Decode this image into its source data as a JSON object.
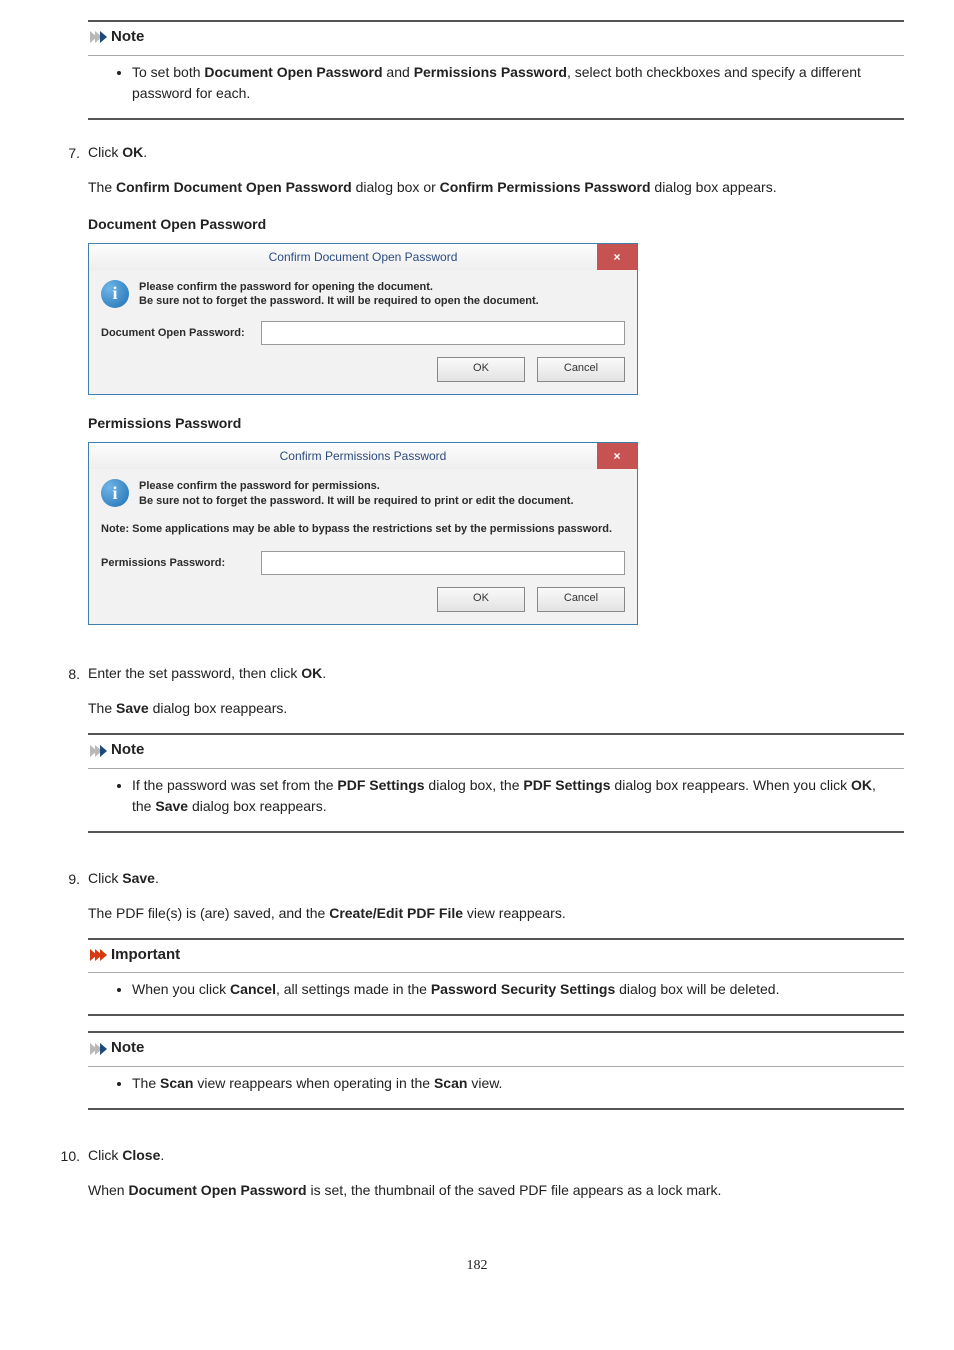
{
  "labels": {
    "note": "Note",
    "important": "Important"
  },
  "note1": {
    "bullet_pre": "To set both ",
    "bold1": "Document Open Password",
    "mid1": " and ",
    "bold2": "Permissions Password",
    "post": ", select both checkboxes and specify a different password for each."
  },
  "step7": {
    "num": "7.",
    "line_pre": "Click ",
    "line_bold": "OK",
    "line_post": ".",
    "p_pre": "The ",
    "p_b1": "Confirm Document Open Password",
    "p_mid": " dialog box or ",
    "p_b2": "Confirm Permissions Password",
    "p_post": " dialog box appears.",
    "heading1": "Document Open Password",
    "heading2": "Permissions Password"
  },
  "dialog1": {
    "title": "Confirm Document Open Password",
    "close": "×",
    "info_glyph": "i",
    "msg1": "Please confirm the password for opening the document.",
    "msg2": "Be sure not to forget the password. It will be required to open the document.",
    "pw_label": "Document Open Password:",
    "ok": "OK",
    "cancel": "Cancel"
  },
  "dialog2": {
    "title": "Confirm Permissions Password",
    "close": "×",
    "info_glyph": "i",
    "msg1": "Please confirm the password for permissions.",
    "msg2": "Be sure not to forget the password. It will be required to print or edit the document.",
    "note": "Note: Some applications may be able to bypass the restrictions set by the permissions password.",
    "pw_label": "Permissions Password:",
    "ok": "OK",
    "cancel": "Cancel"
  },
  "step8": {
    "num": "8.",
    "line_pre": "Enter the set password, then click ",
    "line_bold": "OK",
    "line_post": ".",
    "p_pre": "The ",
    "p_b1": "Save",
    "p_post": " dialog box reappears.",
    "note_pre": "If the password was set from the ",
    "note_b1": "PDF Settings",
    "note_mid1": " dialog box, the ",
    "note_b2": "PDF Settings",
    "note_mid2": " dialog box reappears. When you click ",
    "note_b3": "OK",
    "note_mid3": ", the ",
    "note_b4": "Save",
    "note_post": " dialog box reappears."
  },
  "step9": {
    "num": "9.",
    "line_pre": "Click ",
    "line_bold": "Save",
    "line_post": ".",
    "p_pre": "The PDF file(s) is (are) saved, and the ",
    "p_b1": "Create/Edit PDF File",
    "p_post": " view reappears.",
    "imp_pre": "When you click ",
    "imp_b1": "Cancel",
    "imp_mid1": ", all settings made in the ",
    "imp_b2": "Password Security Settings",
    "imp_post": " dialog box will be deleted.",
    "note_pre": "The ",
    "note_b1": "Scan",
    "note_mid": " view reappears when operating in the ",
    "note_b2": "Scan",
    "note_post": " view."
  },
  "step10": {
    "num": "10.",
    "line_pre": "Click ",
    "line_bold": "Close",
    "line_post": ".",
    "p_pre": "When ",
    "p_b1": "Document Open Password",
    "p_post": " is set, the thumbnail of the saved PDF file appears as a lock mark."
  },
  "page_number": "182"
}
